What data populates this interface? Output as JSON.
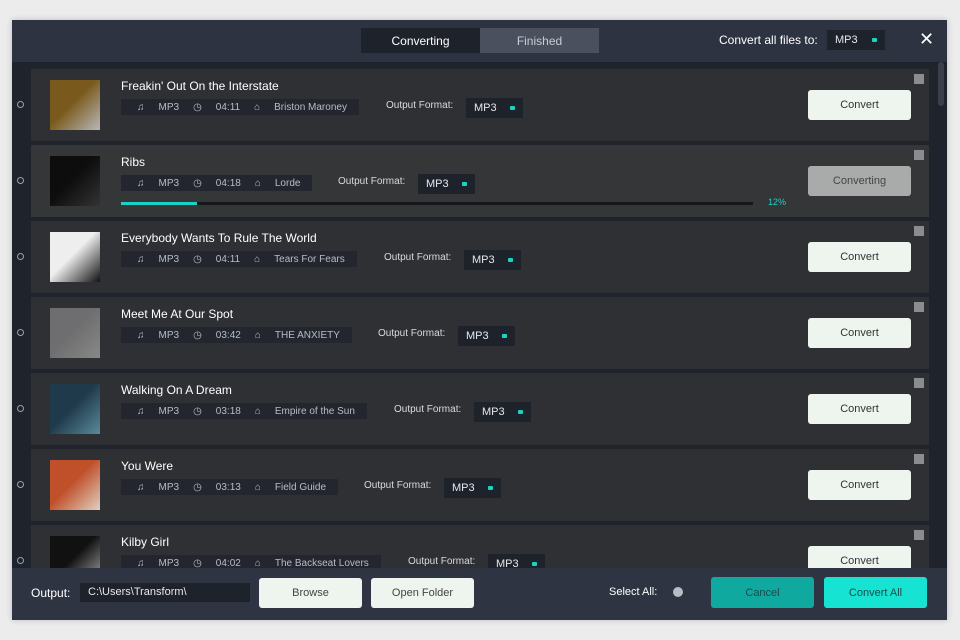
{
  "header": {
    "tabs": [
      {
        "label": "Converting"
      },
      {
        "label": "Finished"
      }
    ],
    "convert_all_label": "Convert all files to:",
    "convert_all_format": "MP3",
    "close": "✕"
  },
  "output_format_label": "Output Format:",
  "tracks": [
    {
      "title": "Freakin' Out On the Interstate",
      "format": "MP3",
      "duration": "04:11",
      "artist": "Briston Maroney",
      "output": "MP3",
      "button": "Convert",
      "thumb": [
        "#7a5a1c",
        "#b8b8b8"
      ]
    },
    {
      "title": "Ribs",
      "format": "MP3",
      "duration": "04:18",
      "artist": "Lorde",
      "output": "MP3",
      "button": "Converting",
      "progress": 12,
      "progress_label": "12%",
      "thumb": [
        "#0d0d0d",
        "#333"
      ]
    },
    {
      "title": "Everybody Wants To Rule The World",
      "format": "MP3",
      "duration": "04:11",
      "artist": "Tears For Fears",
      "output": "MP3",
      "button": "Convert",
      "thumb": [
        "#eee",
        "#111"
      ]
    },
    {
      "title": "Meet Me At Our Spot",
      "format": "MP3",
      "duration": "03:42",
      "artist": "THE ANXIETY",
      "output": "MP3",
      "button": "Convert",
      "thumb": [
        "#6e6e70",
        "#888"
      ]
    },
    {
      "title": "Walking On A Dream",
      "format": "MP3",
      "duration": "03:18",
      "artist": "Empire of the Sun",
      "output": "MP3",
      "button": "Convert",
      "thumb": [
        "#1f3a4a",
        "#5a8a9a"
      ]
    },
    {
      "title": "You Were",
      "format": "MP3",
      "duration": "03:13",
      "artist": "Field Guide",
      "output": "MP3",
      "button": "Convert",
      "thumb": [
        "#c0502a",
        "#e0d0c0"
      ]
    },
    {
      "title": "Kilby Girl",
      "format": "MP3",
      "duration": "04:02",
      "artist": "The Backseat Lovers",
      "output": "MP3",
      "button": "Convert",
      "thumb": [
        "#111",
        "#aaa"
      ]
    }
  ],
  "footer": {
    "output_label": "Output:",
    "output_path": "C:\\Users\\Transform\\",
    "browse": "Browse",
    "open_folder": "Open Folder",
    "select_all": "Select All:",
    "cancel": "Cancel",
    "convert_all": "Convert All"
  },
  "colors": {
    "accent": "#19d3c5",
    "cancel": "#10a9a0"
  }
}
